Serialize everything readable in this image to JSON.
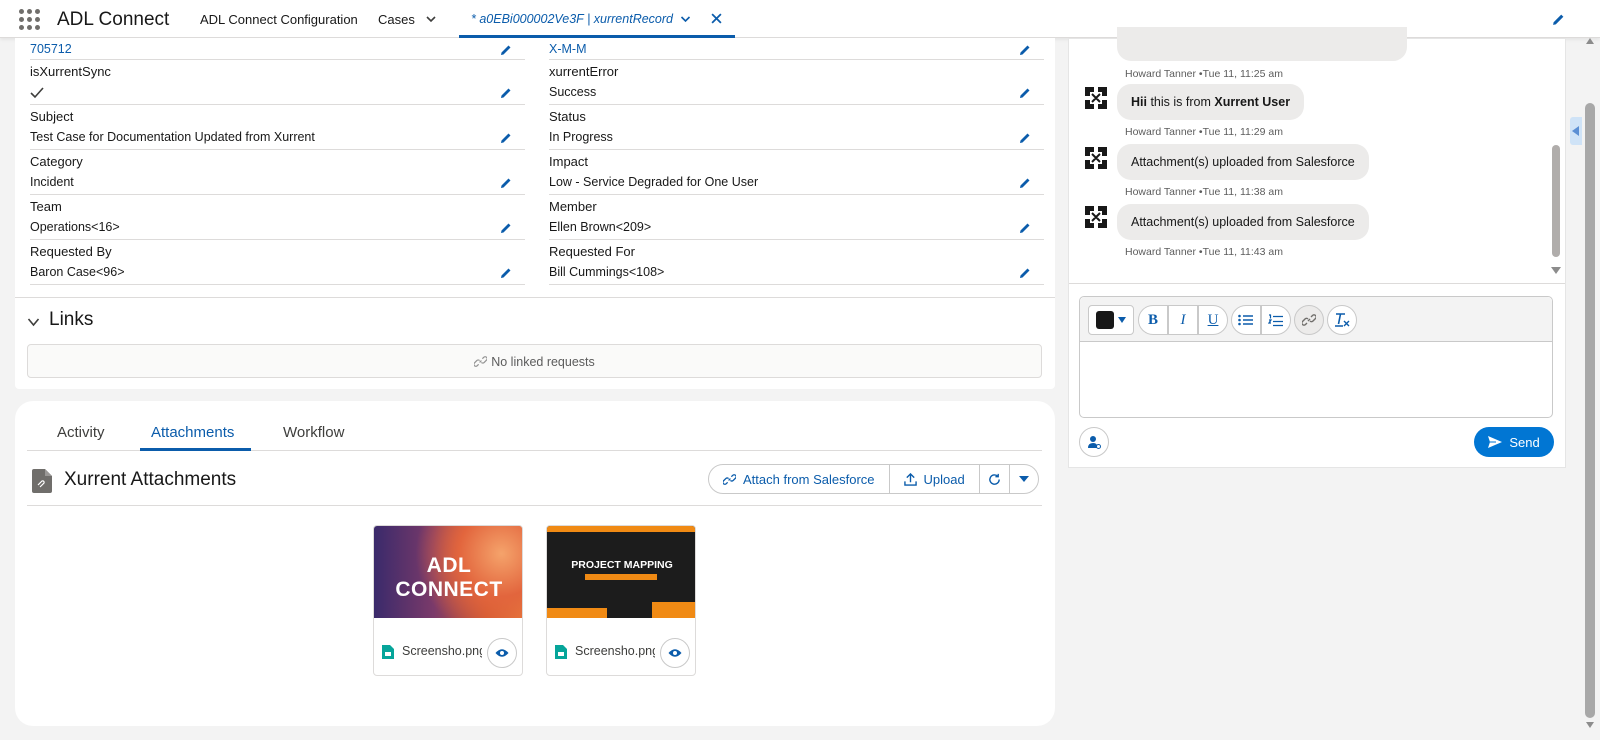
{
  "nav": {
    "app_name": "ADL Connect",
    "items": [
      "ADL Connect Configuration",
      "Cases"
    ],
    "active_tab": "* a0EBi000002Ve3F | xurrentRecord"
  },
  "record": {
    "top_left_value": "705712",
    "top_right_value": "X-M-M",
    "fields": [
      {
        "label": "isXurrentSync",
        "value": "✓"
      },
      {
        "label": "xurrentError",
        "value": "Success"
      },
      {
        "label": "Subject",
        "value": "Test Case for Documentation Updated from Xurrent"
      },
      {
        "label": "Status",
        "value": "In Progress"
      },
      {
        "label": "Category",
        "value": "Incident"
      },
      {
        "label": "Impact",
        "value": "Low - Service Degraded for One User"
      },
      {
        "label": "Team",
        "value": "Operations<16>"
      },
      {
        "label": "Member",
        "value": "Ellen Brown<209>"
      },
      {
        "label": "Requested By",
        "value": "Baron Case<96>"
      },
      {
        "label": "Requested For",
        "value": "Bill Cummings<108>"
      }
    ]
  },
  "links": {
    "heading": "Links",
    "empty_text": "No linked requests"
  },
  "attachments": {
    "tabs": [
      "Activity",
      "Attachments",
      "Workflow"
    ],
    "active_tab": "Attachments",
    "title": "Xurrent Attachments",
    "buttons": {
      "attach": "Attach from Salesforce",
      "upload": "Upload"
    },
    "files": [
      {
        "name": "Screensho.png",
        "thumb_text": "ADL CONNECT"
      },
      {
        "name": "Screensho.png",
        "thumb_text": "PROJECT MAPPING"
      }
    ]
  },
  "chat": {
    "messages": [
      {
        "author_time": "Howard Tanner •Tue 11, 11:25 am"
      },
      {
        "text_bold_1": "Hii",
        "text_mid": " this is from ",
        "text_bold_2": "Xurrent User",
        "author_time": "Howard Tanner •Tue 11, 11:29 am"
      },
      {
        "text": "Attachment(s) uploaded from Salesforce",
        "author_time": "Howard Tanner •Tue 11, 11:38 am"
      },
      {
        "text": "Attachment(s) uploaded from Salesforce",
        "author_time": "Howard Tanner •Tue 11, 11:43 am"
      }
    ],
    "toolbar": {
      "bold": "B",
      "italic": "I",
      "underline": "U"
    },
    "send_label": "Send",
    "composer_value": ""
  },
  "colors": {
    "brand_blue": "#0b5cab",
    "send_blue": "#0176d3"
  },
  "icons": [
    "app-launcher-icon",
    "chevron-down-icon",
    "close-icon",
    "pencil-icon",
    "check-icon",
    "link-icon",
    "file-icon",
    "upload-icon",
    "refresh-icon",
    "eye-icon",
    "send-icon",
    "mention-icon",
    "list-icon",
    "clear-format-icon"
  ]
}
